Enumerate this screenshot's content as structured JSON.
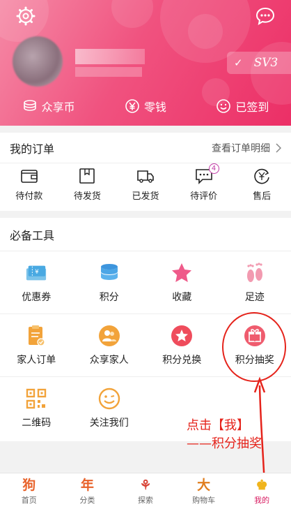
{
  "header": {
    "settings_icon": "gear-icon",
    "message_icon": "chat-bubble-icon",
    "vip_level": "SV3",
    "vip_check": "✓",
    "stats": [
      {
        "icon": "coin-stack-icon",
        "label": "众享币"
      },
      {
        "icon": "yen-circle-icon",
        "label": "零钱"
      },
      {
        "icon": "smile-icon",
        "label": "已签到"
      }
    ]
  },
  "orders": {
    "title": "我的订单",
    "view_all": "查看订单明细",
    "items": [
      {
        "icon": "wallet-icon",
        "label": "待付款"
      },
      {
        "icon": "package-icon",
        "label": "待发货"
      },
      {
        "icon": "truck-icon",
        "label": "已发货"
      },
      {
        "icon": "comment-icon",
        "label": "待评价",
        "badge": "4"
      },
      {
        "icon": "refund-icon",
        "label": "售后"
      }
    ]
  },
  "tools": {
    "title": "必备工具",
    "items": [
      {
        "icon": "coupon-icon",
        "label": "优惠券"
      },
      {
        "icon": "points-database-icon",
        "label": "积分"
      },
      {
        "icon": "star-favorite-icon",
        "label": "收藏"
      },
      {
        "icon": "footprint-icon",
        "label": "足迹"
      },
      {
        "icon": "family-order-icon",
        "label": "家人订单"
      },
      {
        "icon": "family-share-icon",
        "label": "众享家人"
      },
      {
        "icon": "points-exchange-icon",
        "label": "积分兑换"
      },
      {
        "icon": "gift-icon",
        "label": "积分抽奖"
      },
      {
        "icon": "qr-code-icon",
        "label": "二维码"
      },
      {
        "icon": "smile-follow-icon",
        "label": "关注我们"
      }
    ]
  },
  "annotation": {
    "line1": "点击【我】",
    "line2": "——积分抽奖",
    "color": "#e5231b"
  },
  "bottom_nav": {
    "items": [
      {
        "glyph": "狗",
        "label": "首页",
        "color": "#e8622a"
      },
      {
        "glyph": "年",
        "label": "分类",
        "color": "#e8622a"
      },
      {
        "glyph": "⚘",
        "label": "探索",
        "color": "#d9473a"
      },
      {
        "glyph": "大",
        "label": "购物车",
        "color": "#e07d1e"
      },
      {
        "glyph": "♚",
        "label": "我的",
        "color": "#f0b41c"
      }
    ],
    "active": "我的"
  },
  "colors": {
    "brand_pink": "#ec2f66",
    "badge_purple": "#c239a6"
  }
}
